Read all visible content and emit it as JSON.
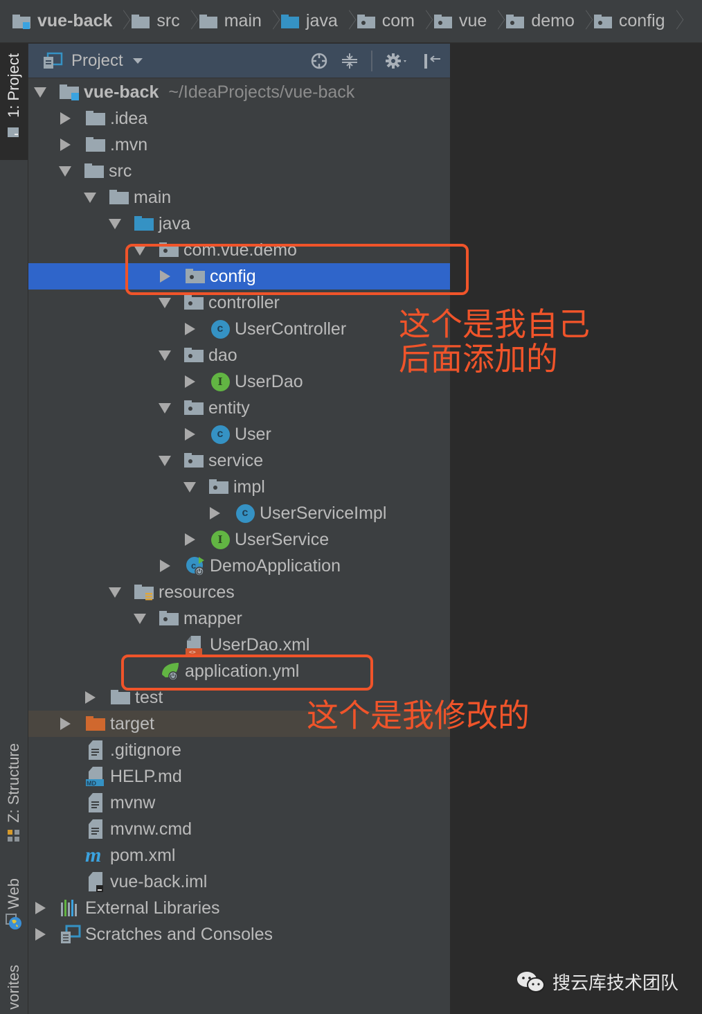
{
  "breadcrumb": [
    {
      "label": "vue-back",
      "icon": "module-folder-icon",
      "bold": true
    },
    {
      "label": "src",
      "icon": "folder-icon"
    },
    {
      "label": "main",
      "icon": "folder-icon"
    },
    {
      "label": "java",
      "icon": "source-folder-icon"
    },
    {
      "label": "com",
      "icon": "package-icon"
    },
    {
      "label": "vue",
      "icon": "package-icon"
    },
    {
      "label": "demo",
      "icon": "package-icon"
    },
    {
      "label": "config",
      "icon": "package-icon"
    }
  ],
  "tool_strip": {
    "project": "1: Project",
    "structure": "Z: Structure",
    "web": "Web",
    "favorites": "vorites"
  },
  "panel": {
    "title": "Project",
    "tools": [
      "locate-icon",
      "collapse-all-icon",
      "gear-icon",
      "hide-icon"
    ]
  },
  "tree": [
    {
      "label": "vue-back",
      "path": "~/IdeaProjects/vue-back",
      "depth": 0,
      "arrow": "down",
      "icon": "module",
      "bold": true
    },
    {
      "label": ".idea",
      "depth": 1,
      "arrow": "right",
      "icon": "folder"
    },
    {
      "label": ".mvn",
      "depth": 1,
      "arrow": "right",
      "icon": "folder"
    },
    {
      "label": "src",
      "depth": 1,
      "arrow": "down",
      "icon": "folder"
    },
    {
      "label": "main",
      "depth": 2,
      "arrow": "down",
      "icon": "folder"
    },
    {
      "label": "java",
      "depth": 3,
      "arrow": "down",
      "icon": "source"
    },
    {
      "label": "com.vue.demo",
      "depth": 4,
      "arrow": "down",
      "icon": "package"
    },
    {
      "label": "config",
      "depth": 5,
      "arrow": "right",
      "icon": "package",
      "selected": true
    },
    {
      "label": "controller",
      "depth": 5,
      "arrow": "down",
      "icon": "package"
    },
    {
      "label": "UserController",
      "depth": 6,
      "arrow": "right",
      "icon": "class"
    },
    {
      "label": "dao",
      "depth": 5,
      "arrow": "down",
      "icon": "package"
    },
    {
      "label": "UserDao",
      "depth": 6,
      "arrow": "right",
      "icon": "interface"
    },
    {
      "label": "entity",
      "depth": 5,
      "arrow": "down",
      "icon": "package"
    },
    {
      "label": "User",
      "depth": 6,
      "arrow": "right",
      "icon": "class"
    },
    {
      "label": "service",
      "depth": 5,
      "arrow": "down",
      "icon": "package"
    },
    {
      "label": "impl",
      "depth": 6,
      "arrow": "down",
      "icon": "package"
    },
    {
      "label": "UserServiceImpl",
      "depth": 7,
      "arrow": "right",
      "icon": "class"
    },
    {
      "label": "UserService",
      "depth": 6,
      "arrow": "right",
      "icon": "interface"
    },
    {
      "label": "DemoApplication",
      "depth": 5,
      "arrow": "right",
      "icon": "spring-app"
    },
    {
      "label": "resources",
      "depth": 3,
      "arrow": "down",
      "icon": "resources"
    },
    {
      "label": "mapper",
      "depth": 4,
      "arrow": "down",
      "icon": "package"
    },
    {
      "label": "UserDao.xml",
      "depth": 5,
      "arrow": "none",
      "icon": "xml"
    },
    {
      "label": "application.yml",
      "depth": 4,
      "arrow": "none",
      "icon": "spring-yml"
    },
    {
      "label": "test",
      "depth": 2,
      "arrow": "right",
      "icon": "folder"
    },
    {
      "label": "target",
      "depth": 1,
      "arrow": "right",
      "icon": "excluded",
      "highlight": true
    },
    {
      "label": ".gitignore",
      "depth": 1,
      "arrow": "none",
      "icon": "text"
    },
    {
      "label": "HELP.md",
      "depth": 1,
      "arrow": "none",
      "icon": "markdown"
    },
    {
      "label": "mvnw",
      "depth": 1,
      "arrow": "none",
      "icon": "text"
    },
    {
      "label": "mvnw.cmd",
      "depth": 1,
      "arrow": "none",
      "icon": "text"
    },
    {
      "label": "pom.xml",
      "depth": 1,
      "arrow": "none",
      "icon": "maven"
    },
    {
      "label": "vue-back.iml",
      "depth": 1,
      "arrow": "none",
      "icon": "iml"
    },
    {
      "label": "External Libraries",
      "depth": 0,
      "arrow": "right",
      "icon": "libraries"
    },
    {
      "label": "Scratches and Consoles",
      "depth": 0,
      "arrow": "right",
      "icon": "scratches"
    }
  ],
  "annotations": {
    "note1_line1": "这个是我自己",
    "note1_line2": "后面添加的",
    "note2": "这个是我修改的",
    "color": "#f0542a"
  },
  "watermark": "搜云库技术团队",
  "colors": {
    "selection": "#2f65ca",
    "panel_bg": "#3c3f41",
    "editor_bg": "#2b2b2b",
    "class_icon": "#3592c4",
    "interface_icon": "#62b543",
    "excluded_folder": "#d0682e"
  }
}
